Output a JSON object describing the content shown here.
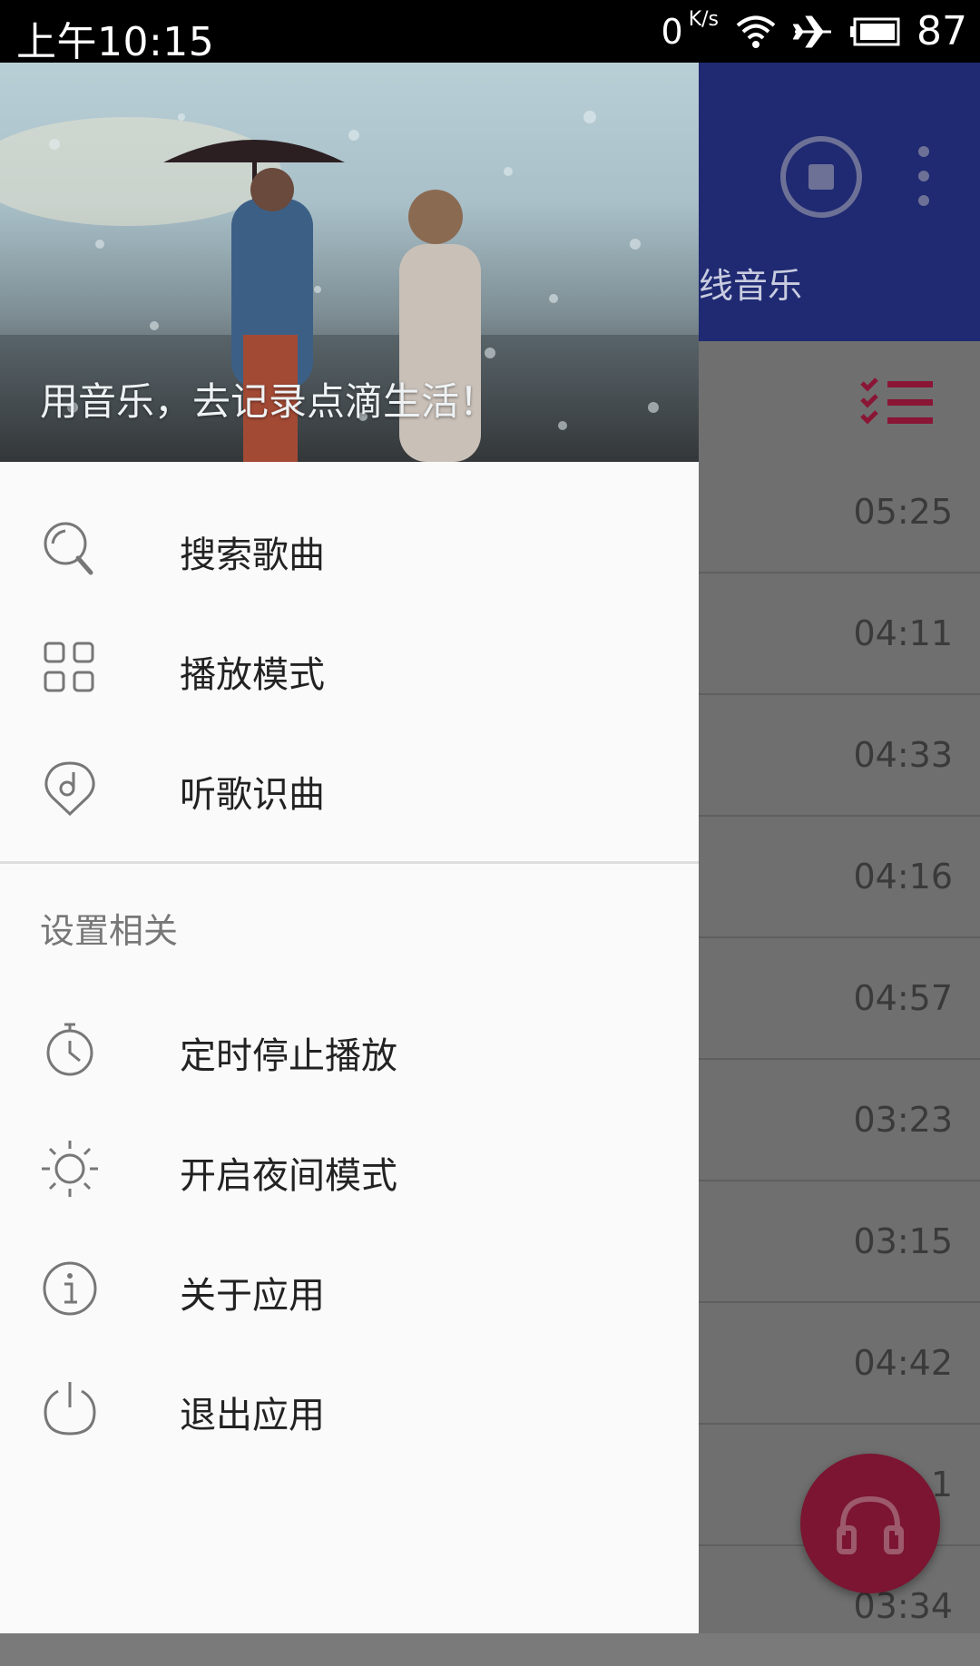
{
  "status_bar": {
    "time": "上午10:15",
    "net_speed": "0",
    "net_speed_unit": "K/s",
    "battery": "87"
  },
  "background_app": {
    "tab_online_partial": "线音乐",
    "durations": [
      "05:25",
      "04:11",
      "04:33",
      "04:16",
      "04:57",
      "03:23",
      "03:15",
      "04:42",
      "1",
      "03:34"
    ],
    "accent_color": "#1f2a72",
    "fab_color": "#7b1531"
  },
  "drawer": {
    "slogan": "用音乐，去记录点滴生活！",
    "menu": [
      {
        "label": "搜索歌曲",
        "icon": "search-icon"
      },
      {
        "label": "播放模式",
        "icon": "grid-icon"
      },
      {
        "label": "听歌识曲",
        "icon": "music-recognize-icon"
      }
    ],
    "settings_section_title": "设置相关",
    "settings": [
      {
        "label": "定时停止播放",
        "icon": "timer-icon"
      },
      {
        "label": "开启夜间模式",
        "icon": "sun-icon"
      },
      {
        "label": "关于应用",
        "icon": "info-icon"
      },
      {
        "label": "退出应用",
        "icon": "power-icon"
      }
    ]
  }
}
